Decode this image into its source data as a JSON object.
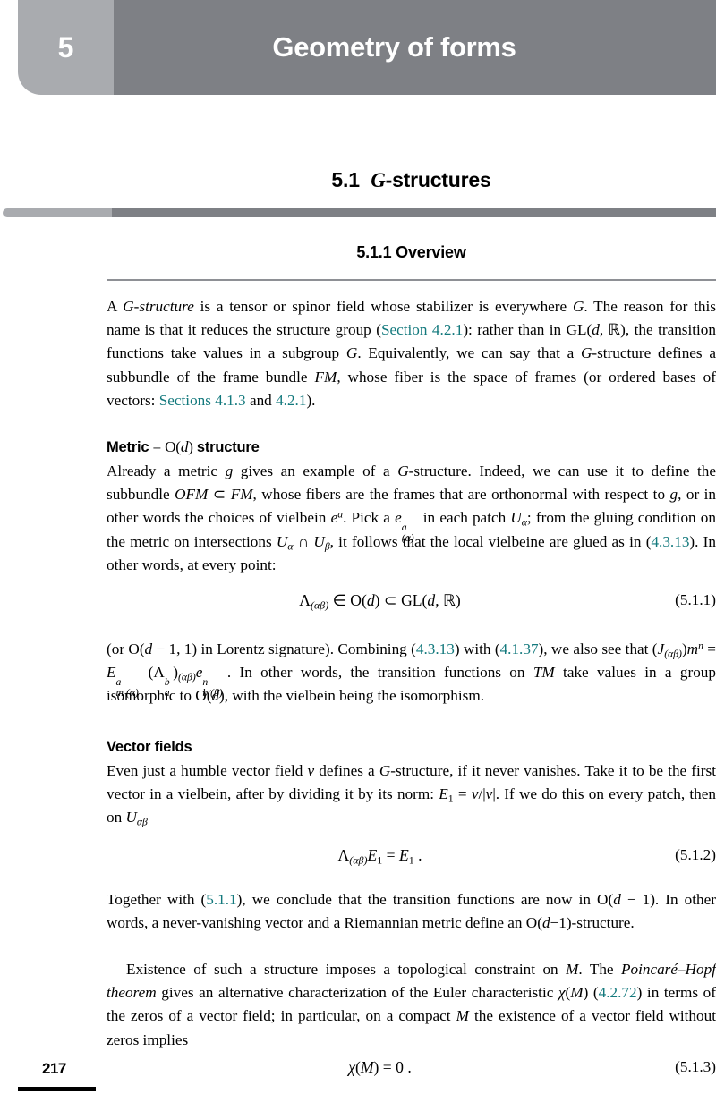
{
  "banner": {
    "chapter_number": "5",
    "chapter_title": "Geometry of forms",
    "light_color": "#a9abaf",
    "dark_color": "#7e8085"
  },
  "section": {
    "number": "5.1",
    "title_math": "G",
    "title_rest": "-structures"
  },
  "subsection": {
    "label": "5.1.1  Overview"
  },
  "link_color": "#13797d",
  "paragraphs": {
    "p1": {
      "t1": "A ",
      "i1": "G-structure",
      "t2": " is a tensor or spinor field whose stabilizer is everywhere ",
      "m1": "G",
      "t3": ". The reason for this name is that it reduces the structure group (",
      "l1": "Section 4.2.1",
      "t4": "): rather than in GL(",
      "m2": "d",
      "t5": ", ℝ), the transition functions take values in a subgroup ",
      "m3": "G",
      "t6": ". Equivalently, we can say that a ",
      "m4": "G",
      "t7": "-structure defines a subbundle of the frame bundle ",
      "m5": "FM",
      "t8": ", whose fiber is the space of frames (or ordered bases of vectors: ",
      "l2": "Sections 4.1.3",
      "t9": " and ",
      "l3": "4.2.1",
      "t10": ")."
    },
    "h1": {
      "pre": "Metric",
      "eq": " = O(",
      "var": "d",
      "post": ") ",
      "tail": "structure"
    },
    "p2": {
      "t1": "Already a metric ",
      "m1": "g",
      "t2": " gives an example of a ",
      "m2": "G",
      "t3": "-structure. Indeed, we can use it to define the subbundle ",
      "m3": "OFM",
      "t4": " ⊂ ",
      "m4": "FM",
      "t5": ", whose fibers are the frames that are orthonormal with respect to ",
      "m5": "g",
      "t6": ", or in other words the choices of vielbein ",
      "m6": "e",
      "m6sup": "a",
      "t7": ". Pick a ",
      "m7": "e",
      "m7up": "a",
      "m7dn": "(α)",
      "t8": " in each patch ",
      "m8": "U",
      "m8sub": "α",
      "t9": "; from the gluing condition on the metric on intersections ",
      "m9": "U",
      "m9sub": "α",
      "t10": " ∩ ",
      "m10": "U",
      "m10sub": "β",
      "t11": ", it follows that the local vielbeine are glued as in (",
      "l1": "4.3.13",
      "t12": "). In other words, at every point:"
    },
    "p3": {
      "t1": "(or O(",
      "m1": "d",
      "t2": " − 1, 1) in Lorentz signature). Combining (",
      "l1": "4.3.13",
      "t3": ") with (",
      "l2": "4.1.37",
      "t4": "), we also see that (",
      "m2": "J",
      "m2sub": "(αβ)",
      "t5": ")",
      "m3": "m",
      "m3sup": "n",
      "t6": " = ",
      "m4": "E",
      "m4up": "a",
      "m4dn": "m (α)",
      "t7": "(Λ",
      "m5up": "b",
      "m5dn": "a",
      "t8": ")",
      "m6sub": "(αβ)",
      "m7": "e",
      "m7up": "n",
      "m7dn": "b (β)",
      "t9": ". In other words, the transition functions on ",
      "m8": "TM",
      "t10": " take values in a group isomorphic to O(",
      "m9": "d",
      "t11": "), with the vielbein being the isomorphism."
    },
    "h2": {
      "label": "Vector fields"
    },
    "p4": {
      "t1": "Even just a humble vector field ",
      "m1": "v",
      "t2": " defines a ",
      "m2": "G",
      "t3": "-structure, if it never vanishes. Take it to be the first vector in a vielbein, after by dividing it by its norm: ",
      "m3": "E",
      "m3sub": "1",
      "t4": " = ",
      "m4": "v",
      "t5": "/|",
      "m5": "v",
      "t6": "|. If we do this on every patch, then on ",
      "m6": "U",
      "m6sub": "αβ"
    },
    "p5": {
      "t1": "Together with (",
      "l1": "5.1.1",
      "t2": "), we conclude that the transition functions are now in O(",
      "m1": "d",
      "t3": " − 1). In other words, a never-vanishing vector and a Riemannian metric define an O(",
      "m2": "d",
      "t4": "−1)-structure."
    },
    "p6": {
      "t1": "Existence of such a structure imposes a topological constraint on ",
      "m1": "M",
      "t2": ". The ",
      "i1": "Poincaré–Hopf theorem",
      "t3": " gives an alternative characterization of the Euler characteristic ",
      "m2": "χ",
      "t4": "(",
      "m3": "M",
      "t5": ") (",
      "l1": "4.2.72",
      "t6": ") in terms of the zeros of a vector field; in particular, on a compact ",
      "m4": "M",
      "t7": " the existence of a vector field without zeros implies"
    }
  },
  "equations": {
    "eq1": {
      "lhs": "Λ",
      "lhs_sub": "(αβ)",
      "rest_in": " ∈ O(",
      "var1": "d",
      "rest_mid": ") ⊂ GL(",
      "var2": "d",
      "rest_end": ", ℝ)",
      "tag": "(5.1.1)"
    },
    "eq2": {
      "lhs": "Λ",
      "lhs_sub": "(αβ)",
      "e1": "E",
      "e1_sub": "1",
      "eqsign": " = ",
      "e2": "E",
      "e2_sub": "1",
      "period": " .",
      "tag": "(5.1.2)"
    },
    "eq3": {
      "chi": "χ",
      "open": "(",
      "var": "M",
      "close": ") = 0 .",
      "tag": "(5.1.3)"
    }
  },
  "footer": {
    "page_number": "217"
  }
}
